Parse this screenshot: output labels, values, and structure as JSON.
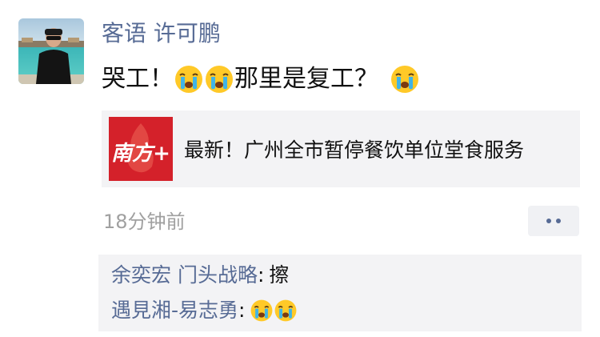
{
  "post": {
    "username": "客语 许可鹏",
    "text_part1": "哭工！",
    "text_part2": "那里是复工？",
    "emoji_name": "crying-face-emoji"
  },
  "link": {
    "source_logo_text": "南方+",
    "title": "最新！广州全市暂停餐饮单位堂食服务"
  },
  "timestamp": "18分钟前",
  "comments": [
    {
      "user": "余奕宏 门头战略",
      "separator": ":",
      "text": "擦"
    },
    {
      "user": "遇見湘-易志勇",
      "separator": ":",
      "text": ""
    }
  ],
  "colors": {
    "link_blue": "#576b95",
    "card_bg": "#f3f3f5",
    "logo_red": "#d4212a"
  }
}
